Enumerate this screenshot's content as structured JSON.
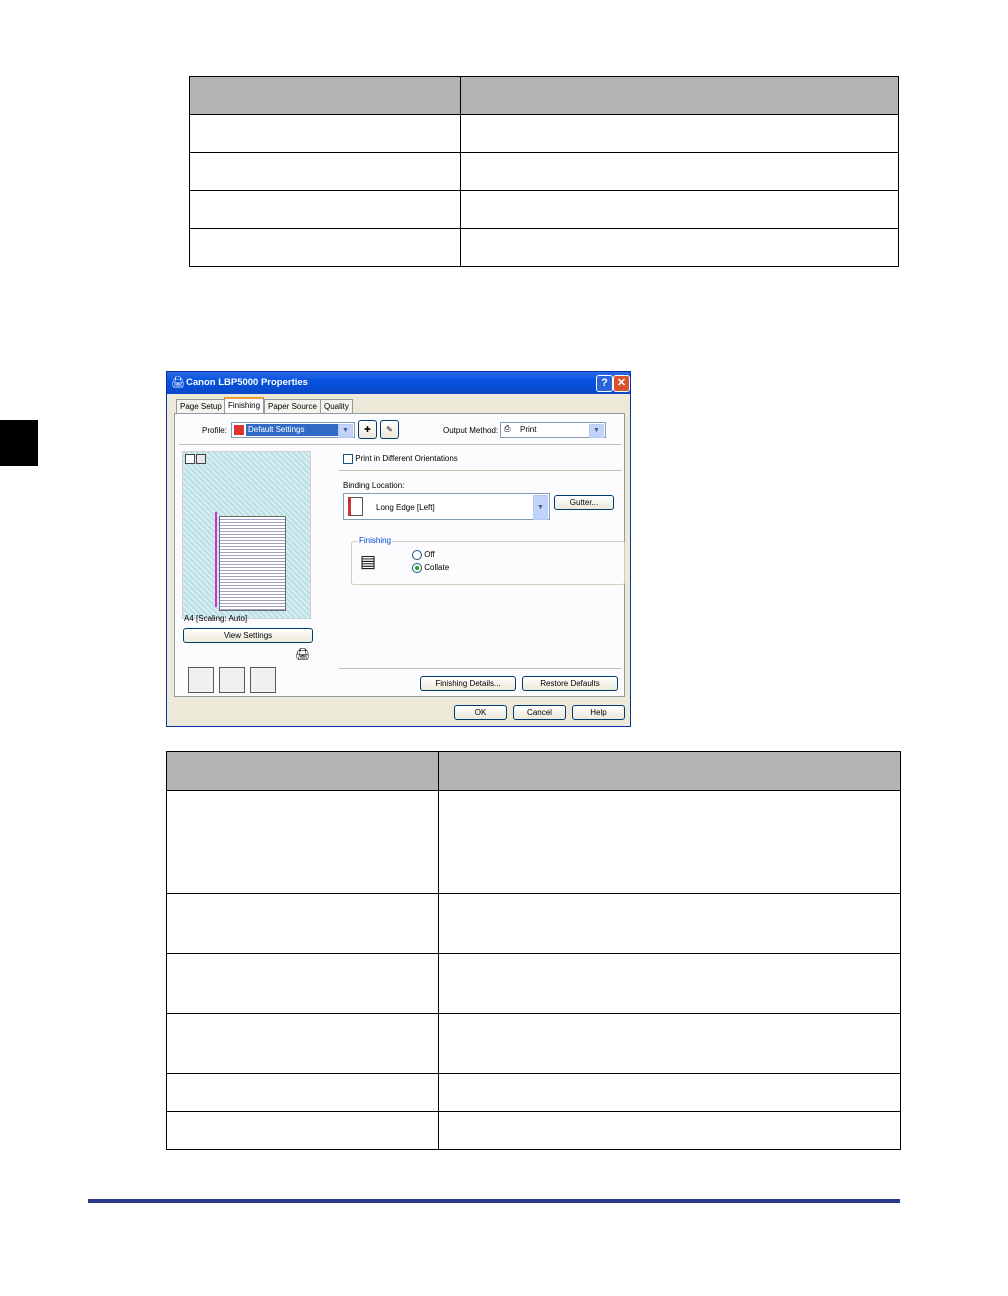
{
  "table1": {
    "rows": [
      [
        "",
        ""
      ],
      [
        "",
        ""
      ],
      [
        "",
        ""
      ],
      [
        "",
        ""
      ],
      [
        "",
        ""
      ]
    ]
  },
  "dialog": {
    "title": "Canon LBP5000 Properties",
    "help_glyph": "?",
    "close_glyph": "✕",
    "tabs": [
      "Page Setup",
      "Finishing",
      "Paper Source",
      "Quality"
    ],
    "profile_label": "Profile:",
    "profile_value": "Default Settings",
    "output_method_label": "Output Method:",
    "output_method_value": "Print",
    "print_orientations_label": "Print in Different Orientations",
    "binding_location_label": "Binding Location:",
    "binding_location_value": "Long Edge [Left]",
    "gutter_button": "Gutter...",
    "finishing_group_label": "Finishing",
    "finishing_options": [
      "Off",
      "Collate"
    ],
    "finishing_selected": "Collate",
    "preview_caption": "A4 [Scaling: Auto]",
    "view_settings_button": "View Settings",
    "finishing_details_button": "Finishing Details...",
    "restore_defaults_button": "Restore Defaults",
    "ok_button": "OK",
    "cancel_button": "Cancel",
    "help_button": "Help"
  },
  "table2": {
    "rows": [
      [
        "",
        ""
      ],
      [
        "",
        ""
      ],
      [
        "",
        ""
      ],
      [
        "",
        ""
      ],
      [
        "",
        ""
      ],
      [
        "",
        ""
      ],
      [
        "",
        ""
      ]
    ]
  },
  "colors": {
    "footer_rule": "#2c3a8c",
    "table_header": "#b4b4b4",
    "titlebar": "#0653df"
  }
}
